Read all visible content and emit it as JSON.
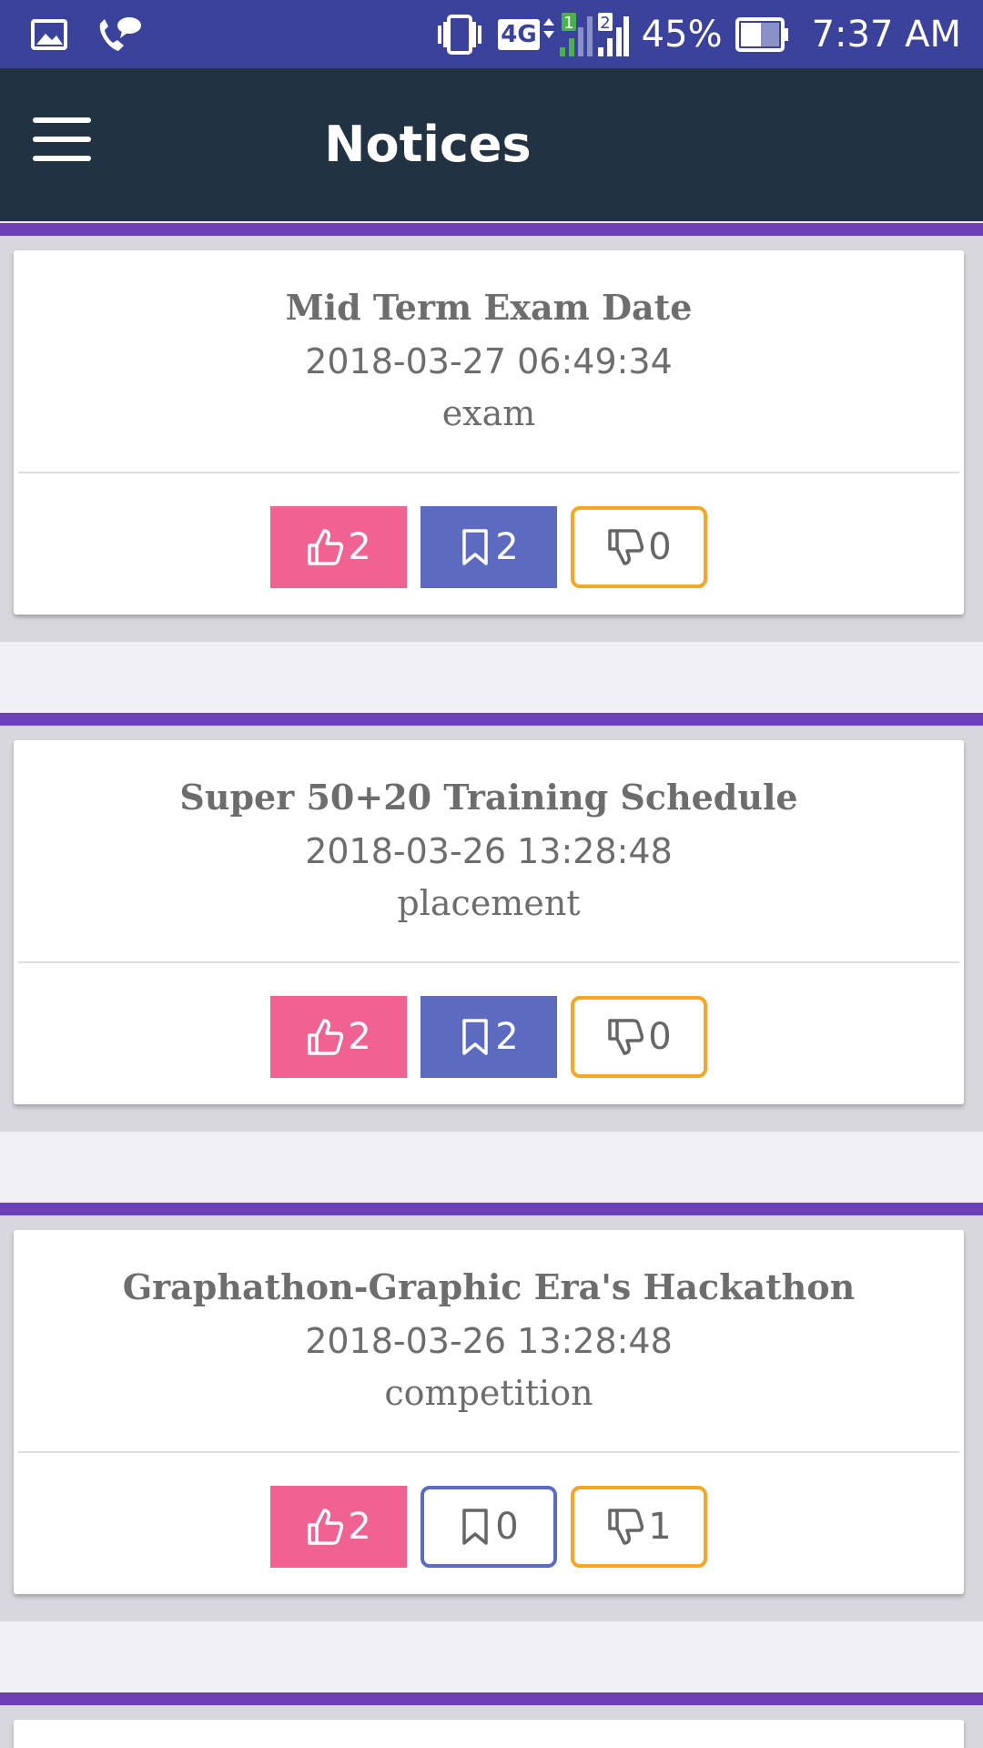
{
  "status_bar": {
    "network": "4G",
    "sim_badge_1": "1",
    "sim_badge_2": "2",
    "battery": "45%",
    "time": "7:37 AM",
    "icons": [
      "gallery-icon",
      "wifi-call-icon",
      "vibrate-icon",
      "signal-icon",
      "battery-icon"
    ]
  },
  "app_bar": {
    "title": "Notices",
    "menu_icon": "menu-icon"
  },
  "colors": {
    "status_bar": "#3b429b",
    "app_bar": "#213243",
    "accent_band": "#6a3fb8",
    "like": "#f06292",
    "bookmark": "#5c6bc0",
    "dislike_border": "#f5a623"
  },
  "notices": [
    {
      "title": "Mid Term Exam Date",
      "date": "2018-03-27 06:49:34",
      "category": "exam",
      "likes": "2",
      "bookmarks": "2",
      "dislikes": "0",
      "bookmarked": true
    },
    {
      "title": "Super 50+20 Training Schedule",
      "date": "2018-03-26 13:28:48",
      "category": "placement",
      "likes": "2",
      "bookmarks": "2",
      "dislikes": "0",
      "bookmarked": true
    },
    {
      "title": "Graphathon-Graphic Era's Hackathon",
      "date": "2018-03-26 13:28:48",
      "category": "competition",
      "likes": "2",
      "bookmarks": "0",
      "dislikes": "1",
      "bookmarked": false
    }
  ]
}
